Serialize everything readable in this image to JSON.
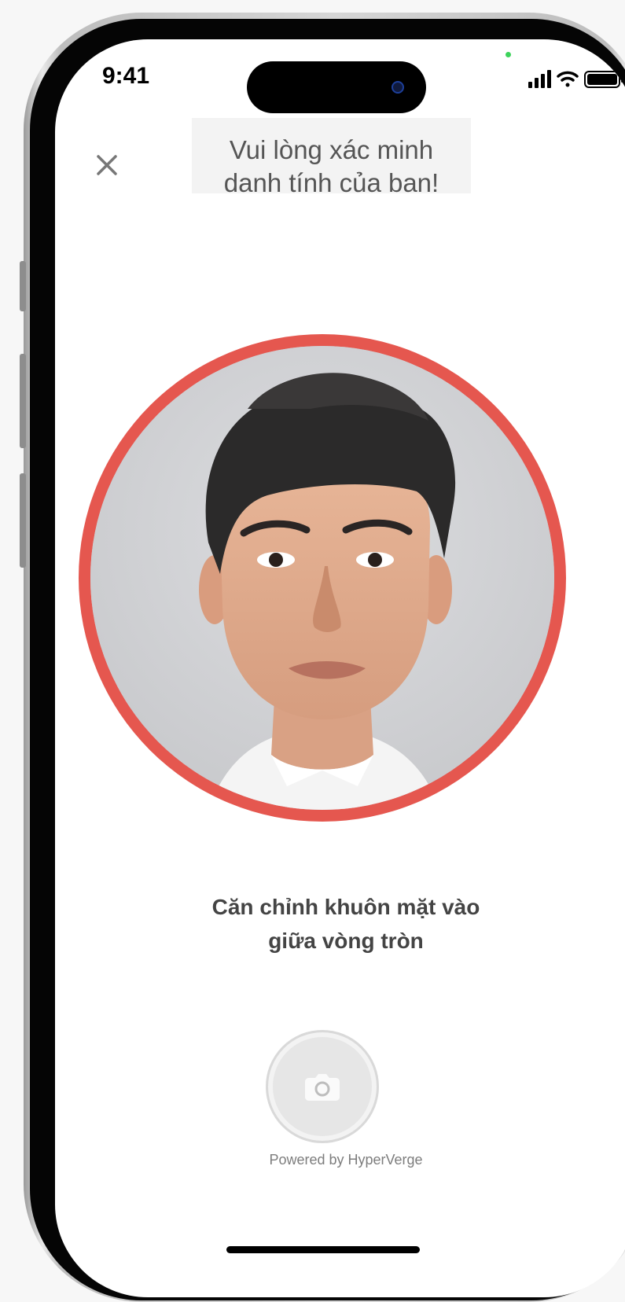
{
  "status_bar": {
    "time": "9:41",
    "icons": [
      "cellular-signal-icon",
      "wifi-icon",
      "battery-icon"
    ]
  },
  "header": {
    "close_icon": "close-icon",
    "title_line1": "Vui lòng xác minh",
    "title_line2": "danh tính của bạn!"
  },
  "face_capture": {
    "ring_color": "#e5574f",
    "instruction_line1": "Căn chỉnh khuôn mặt vào",
    "instruction_line2": "giữa vòng tròn"
  },
  "capture_button": {
    "icon": "camera-icon"
  },
  "footer": {
    "powered_by": "Powered by HyperVerge"
  }
}
